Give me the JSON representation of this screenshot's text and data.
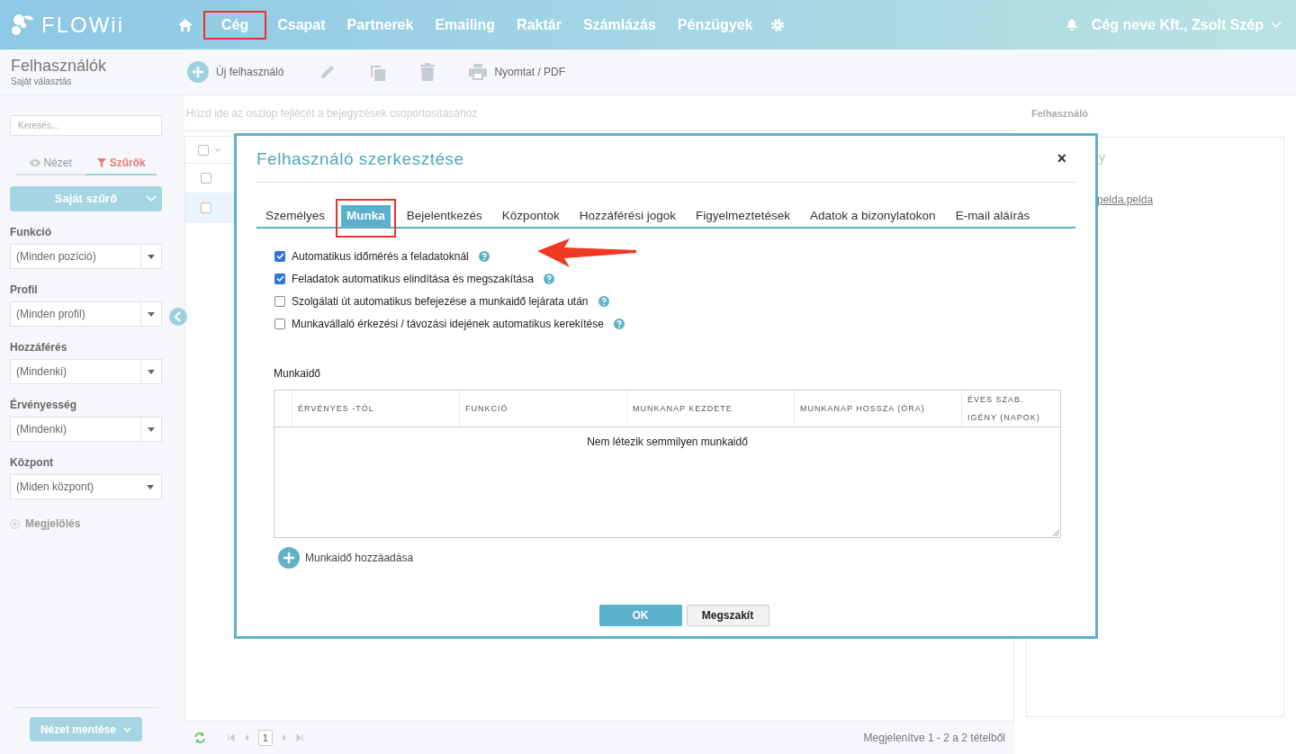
{
  "brand": "FLOWii",
  "nav": [
    {
      "label": "Cég",
      "highlighted": true
    },
    {
      "label": "Csapat",
      "highlighted": false
    },
    {
      "label": "Partnerek",
      "highlighted": false
    },
    {
      "label": "Emailing",
      "highlighted": false
    },
    {
      "label": "Raktár",
      "highlighted": false
    },
    {
      "label": "Számlázás",
      "highlighted": false
    },
    {
      "label": "Pénzügyek",
      "highlighted": false
    }
  ],
  "account": "Cég neve Kft., Zsolt Szép",
  "page": {
    "title": "Felhasználók",
    "subtitle": "Saját választás"
  },
  "toolbar": {
    "new": "Új felhasználó",
    "print": "Nyomtat / PDF"
  },
  "sidebar": {
    "search_placeholder": "Keresés...",
    "tabs": [
      {
        "label": "Nézet",
        "selected": false
      },
      {
        "label": "Szűrők",
        "selected": true
      }
    ],
    "filter_button": "Saját szűrő",
    "filters": [
      {
        "label": "Funkció",
        "value": "(Minden pozíció)",
        "split": true
      },
      {
        "label": "Profil",
        "value": "(Minden profil)",
        "split": true
      },
      {
        "label": "Hozzáférés",
        "value": "(Mindenki)",
        "split": true
      },
      {
        "label": "Érvényesség",
        "value": "(Mindenki)",
        "split": true
      },
      {
        "label": "Központ",
        "value": "(Miden központ)",
        "split": false
      }
    ],
    "mark": "Megjelölés",
    "save_button": "Nézet mentése"
  },
  "grid": {
    "group_hint": "Húzd ide az oszlop fejlécét a bejegyzések csoportosításához",
    "select_all": {
      "checked": false
    },
    "rows": [
      {
        "selected": false,
        "checked": false
      },
      {
        "selected": true,
        "checked": false
      }
    ],
    "page": "1",
    "summary": "Megjelenítve 1 - 2 a 2 tételből"
  },
  "detail": {
    "title": "Felhasználó",
    "cut_text": "y",
    "link": "pelda.pelda"
  },
  "dialog": {
    "title": "Felhasználó szerkesztése",
    "close": "×",
    "tabs": [
      {
        "label": "Személyes",
        "selected": false,
        "highlighted": false
      },
      {
        "label": "Munka",
        "selected": true,
        "highlighted": true
      },
      {
        "label": "Bejelentkezés",
        "selected": false,
        "highlighted": false
      },
      {
        "label": "Központok",
        "selected": false,
        "highlighted": false
      },
      {
        "label": "Hozzáférési jogok",
        "selected": false,
        "highlighted": false
      },
      {
        "label": "Figyelmeztetések",
        "selected": false,
        "highlighted": false
      },
      {
        "label": "Adatok a bizonylatokon",
        "selected": false,
        "highlighted": false
      },
      {
        "label": "E-mail aláírás",
        "selected": false,
        "highlighted": false
      }
    ],
    "options": [
      {
        "label": "Automatikus időmérés a feladatoknál",
        "checked": true
      },
      {
        "label": "Feladatok automatikus elindítása és megszakítása",
        "checked": true
      },
      {
        "label": "Szolgálati út automatikus befejezése a munkaidő lejárata után",
        "checked": false
      },
      {
        "label": "Munkavállaló érkezési / távozási idejének automatikus kerekítése",
        "checked": false
      }
    ],
    "section": "Munkaidő",
    "table": {
      "columns": [
        "ÉRVÉNYES -TÓL",
        "FUNKCIÓ",
        "MUNKANAP KEZDETE",
        "MUNKANAP HOSSZA (ÓRA)",
        "ÉVES SZAB. IGÉNY (NAPOK)"
      ],
      "empty": "Nem létezik semmilyen munkaidő"
    },
    "add": "Munkaidő hozzáadása",
    "buttons": [
      {
        "label": "OK",
        "kind": "primary"
      },
      {
        "label": "Megszakít",
        "kind": "secondary"
      }
    ]
  }
}
